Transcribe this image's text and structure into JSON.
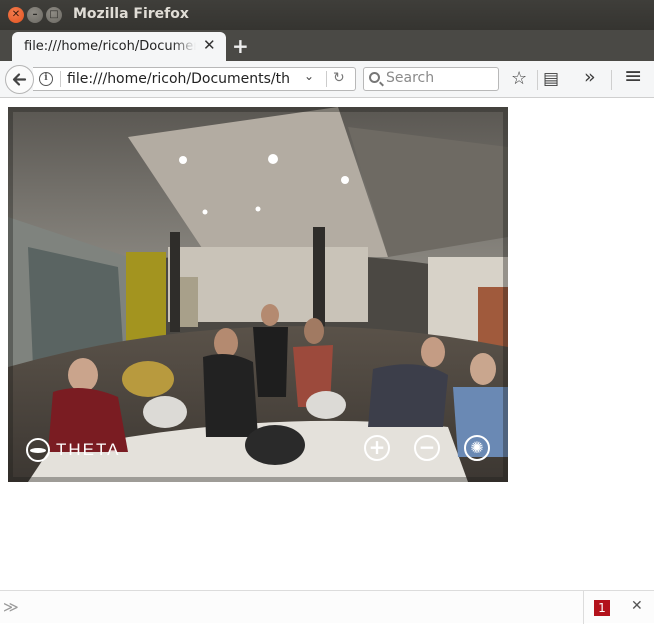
{
  "window": {
    "title": "Mozilla Firefox",
    "close_glyph": "✕",
    "minimize_glyph": "–",
    "maximize_glyph": "□"
  },
  "tab": {
    "label": "file:///home/ricoh/Documents/theta",
    "close_glyph": "✕"
  },
  "new_tab_glyph": "+",
  "navbar": {
    "back_glyph": "←",
    "info_glyph": "i",
    "url": "file:///home/ricoh/Documents/th",
    "dropdown_glyph": "⌄",
    "reload_glyph": "↻",
    "search_placeholder": "Search",
    "bookmark_glyph": "☆",
    "reader_glyph": "▤",
    "overflow_glyph": "»",
    "menu_glyph": "≡"
  },
  "viewer": {
    "logo_text": "THETA",
    "zoom_in_glyph": "+",
    "zoom_out_glyph": "−",
    "auto_rotate_glyph": "✺"
  },
  "bottombar": {
    "chevron_glyph": "≫",
    "badge_count": "1",
    "close_glyph": "✕"
  },
  "colors": {
    "titlebar": "#3a3935",
    "tab_active": "#f5f6f7",
    "close_button": "#e95420",
    "badge": "#b3121b"
  },
  "icons": [
    "back-icon",
    "info-icon",
    "dropdown-icon",
    "reload-icon",
    "search-icon",
    "bookmark-star-icon",
    "reader-icon",
    "overflow-icon",
    "hamburger-menu-icon",
    "theta-logo-icon",
    "zoom-in-icon",
    "zoom-out-icon",
    "auto-rotate-icon"
  ]
}
